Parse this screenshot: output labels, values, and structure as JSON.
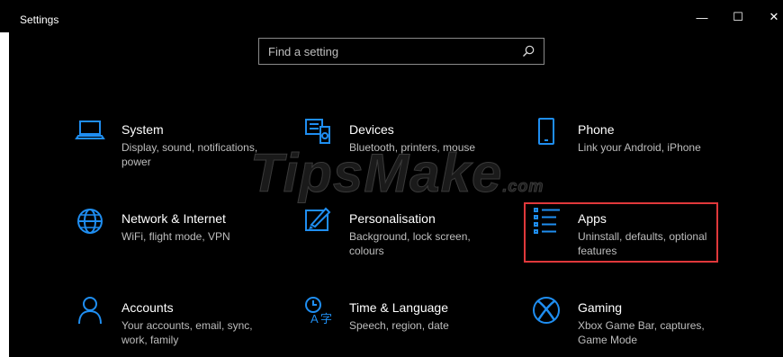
{
  "window": {
    "title": "Settings",
    "minimize": "—",
    "maximize": "☐",
    "close": "✕"
  },
  "search": {
    "placeholder": "Find a setting"
  },
  "watermark": "TipsMake",
  "watermark_suffix": ".com",
  "tiles": [
    {
      "label": "System",
      "desc": "Display, sound, notifications, power",
      "icon": "laptop-icon"
    },
    {
      "label": "Devices",
      "desc": "Bluetooth, printers, mouse",
      "icon": "devices-icon"
    },
    {
      "label": "Phone",
      "desc": "Link your Android, iPhone",
      "icon": "phone-icon"
    },
    {
      "label": "Network & Internet",
      "desc": "WiFi, flight mode, VPN",
      "icon": "globe-icon"
    },
    {
      "label": "Personalisation",
      "desc": "Background, lock screen, colours",
      "icon": "paint-icon"
    },
    {
      "label": "Apps",
      "desc": "Uninstall, defaults, optional features",
      "icon": "apps-list-icon"
    },
    {
      "label": "Accounts",
      "desc": "Your accounts, email, sync, work, family",
      "icon": "person-icon"
    },
    {
      "label": "Time & Language",
      "desc": "Speech, region, date",
      "icon": "time-language-icon"
    },
    {
      "label": "Gaming",
      "desc": "Xbox Game Bar, captures, Game Mode",
      "icon": "xbox-icon"
    }
  ],
  "colors": {
    "accent": "#1f8ef1",
    "highlight_border": "#e0383b",
    "background": "#000000"
  }
}
